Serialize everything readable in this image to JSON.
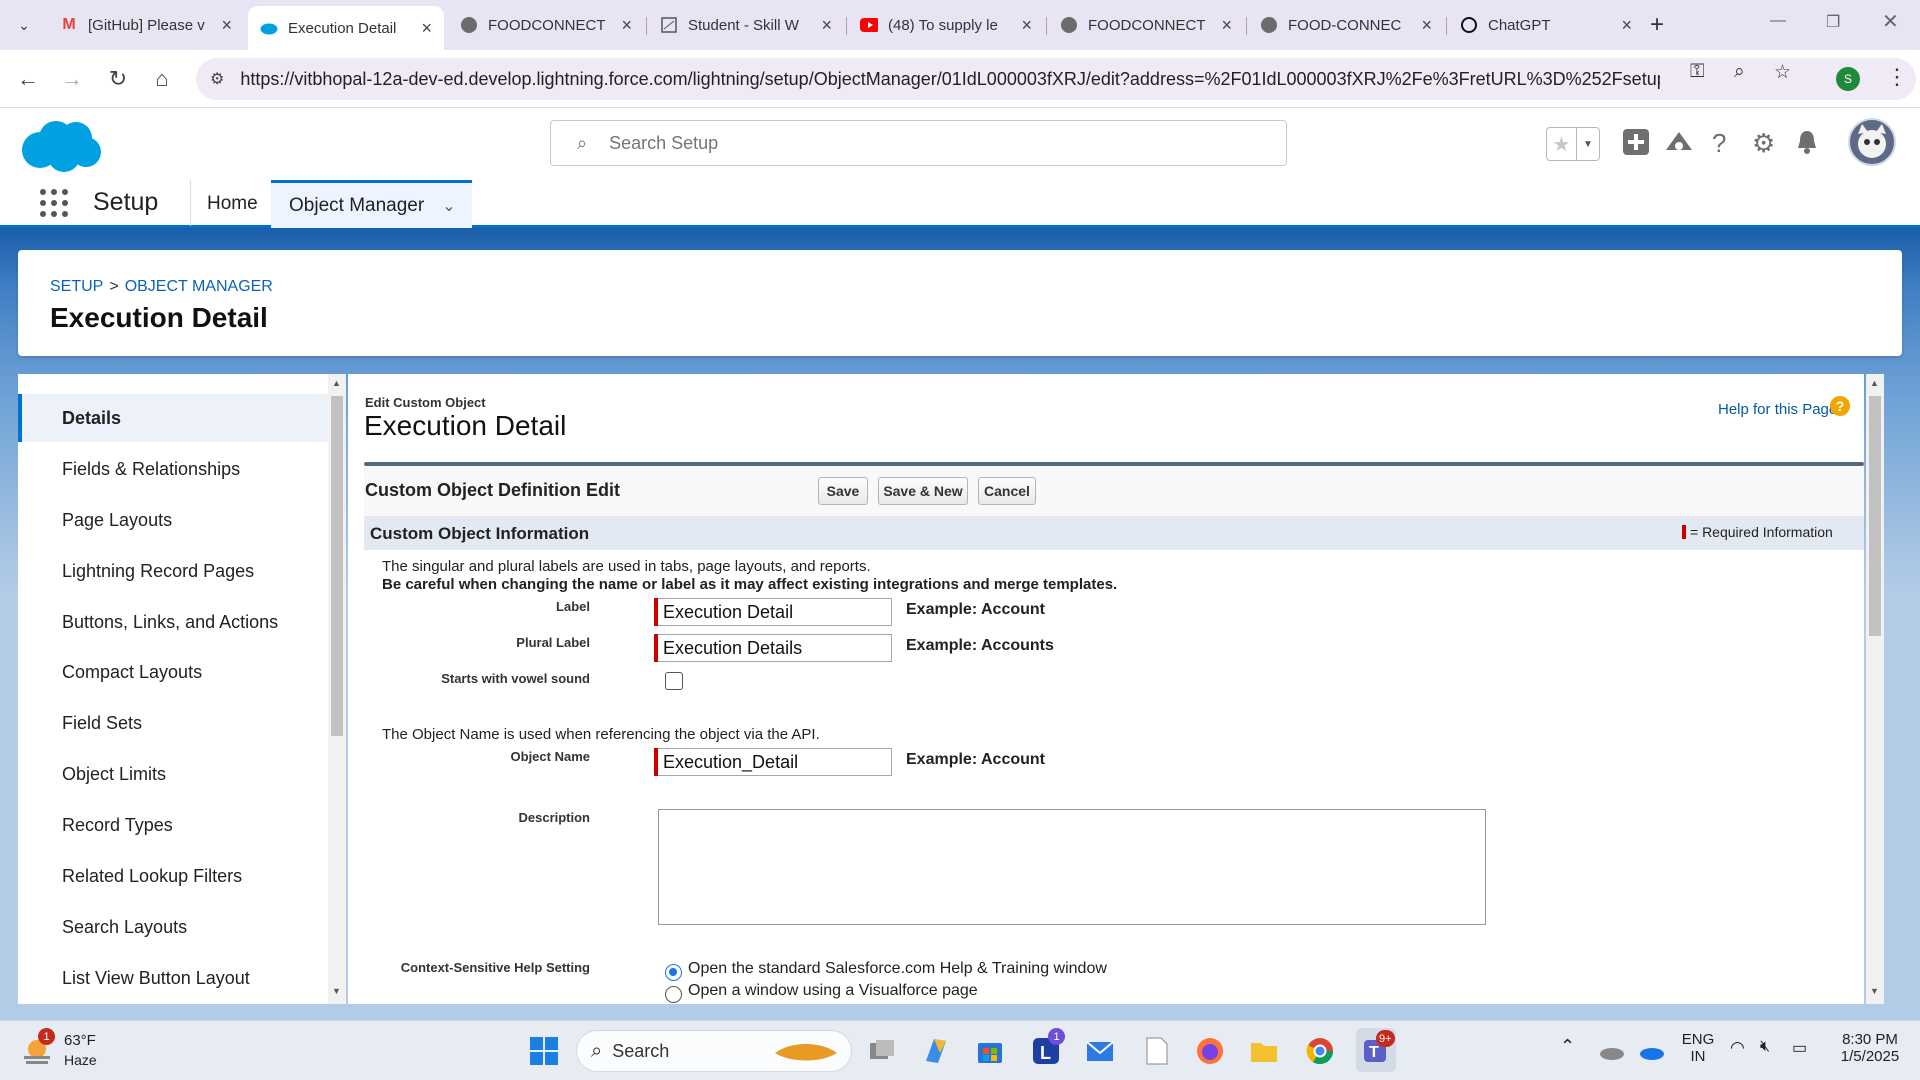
{
  "browser": {
    "tabs": [
      {
        "title": "[GitHub] Please v",
        "icon": "gmail-icon",
        "color": "#ea4335"
      },
      {
        "title": "Execution Detail",
        "icon": "salesforce-icon",
        "color": "#00a1e0",
        "active": true
      },
      {
        "title": "FOODCONNECT",
        "icon": "github-icon",
        "color": "#333333"
      },
      {
        "title": "Student - Skill W",
        "icon": "document-icon",
        "color": "#555555"
      },
      {
        "title": "(48) To supply le",
        "icon": "youtube-icon",
        "color": "#ff0000"
      },
      {
        "title": "FOODCONNECT",
        "icon": "github-icon",
        "color": "#333333"
      },
      {
        "title": "FOOD-CONNEC",
        "icon": "github-icon",
        "color": "#333333"
      },
      {
        "title": "ChatGPT",
        "icon": "chatgpt-icon",
        "color": "#111111"
      }
    ],
    "url": "https://vitbhopal-12a-dev-ed.develop.lightning.force.com/lightning/setup/ObjectManager/01IdL000003fXRJ/edit?address=%2F01IdL000003fXRJ%2Fe%3FretURL%3D%252Fsetup%252F...",
    "profile_initial": "S"
  },
  "sf_header": {
    "search_placeholder": "Search Setup",
    "accent": "#0070d2"
  },
  "appnav": {
    "app_name": "Setup",
    "home_label": "Home",
    "object_manager_label": "Object Manager"
  },
  "page_header": {
    "crumb_setup": "SETUP",
    "crumb_sep": ">",
    "crumb_object_manager": "OBJECT MANAGER",
    "title": "Execution Detail"
  },
  "sidebar": {
    "items": [
      {
        "label": "Details",
        "active": true
      },
      {
        "label": "Fields & Relationships"
      },
      {
        "label": "Page Layouts"
      },
      {
        "label": "Lightning Record Pages"
      },
      {
        "label": "Buttons, Links, and Actions"
      },
      {
        "label": "Compact Layouts"
      },
      {
        "label": "Field Sets"
      },
      {
        "label": "Object Limits"
      },
      {
        "label": "Record Types"
      },
      {
        "label": "Related Lookup Filters"
      },
      {
        "label": "Search Layouts"
      },
      {
        "label": "List View Button Layout"
      }
    ]
  },
  "main": {
    "eyebrow": "Edit Custom Object",
    "title": "Execution Detail",
    "help_link": "Help for this Page",
    "help_glyph": "?",
    "block_title": "Custom Object Definition Edit",
    "buttons": {
      "save": "Save",
      "save_new": "Save & New",
      "cancel": "Cancel"
    },
    "section_title": "Custom Object Information",
    "required_legend": "= Required Information",
    "info_line1": "The singular and plural labels are used in tabs, page layouts, and reports.",
    "info_line2": "Be careful when changing the name or label as it may affect existing integrations and merge templates.",
    "fields": {
      "label": {
        "label": "Label",
        "value": "Execution Detail",
        "example": "Example:  Account"
      },
      "plural": {
        "label": "Plural Label",
        "value": "Execution Details",
        "example": "Example:  Accounts"
      },
      "vowel": {
        "label": "Starts with vowel sound",
        "checked": false
      },
      "api_info": "The Object Name is used when referencing the object via the API.",
      "object_name": {
        "label": "Object Name",
        "value": "Execution_Detail",
        "example": "Example:  Account"
      },
      "description": {
        "label": "Description",
        "value": ""
      },
      "help_setting": {
        "label": "Context-Sensitive Help Setting",
        "options": [
          {
            "label": "Open the standard Salesforce.com Help & Training window",
            "selected": true
          },
          {
            "label": "Open a window using a Visualforce page",
            "selected": false
          }
        ]
      }
    }
  },
  "taskbar": {
    "weather_temp": "63°F",
    "weather_desc": "Haze",
    "weather_badge": "1",
    "search_label": "Search",
    "teams_badge": "9+",
    "app_badge": "1",
    "lang_line1": "ENG",
    "lang_line2": "IN",
    "time": "8:30 PM",
    "date": "1/5/2025"
  }
}
